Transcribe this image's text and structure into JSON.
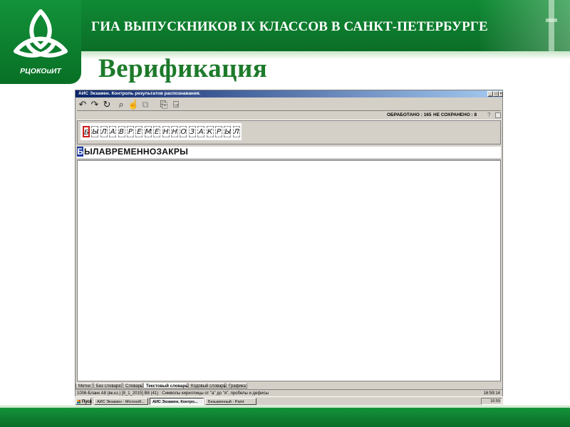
{
  "slide": {
    "header_title": "ГИА ВЫПУСКНИКОВ IX КЛАССОВ В САНКТ-ПЕТЕРБУРГЕ",
    "page_title": "Верификация",
    "logo_text": "РЦОКОиИТ"
  },
  "app": {
    "window_title": "АИС Экзамен. Контроль результатов распознавания.",
    "processed": "ОБРАБОТАНО : 165",
    "unsaved": "НЕ СОХРАНЕНО : 8",
    "help_glyph": "?",
    "scan_letters": [
      "Б",
      "Ы",
      "Л",
      "А",
      "В",
      "Р",
      "Е",
      "М",
      "Е",
      "Н",
      "Н",
      "О",
      "З",
      "А",
      "К",
      "Р",
      "Ы",
      "Л"
    ],
    "recognized_first": "Б",
    "recognized_rest": "ЫЛАВРЕМЕННОЗАКРЫ",
    "tabs": [
      "Метки",
      "Без словаря",
      "Словарь",
      "Текстовый словарь",
      "Кодовый словарь",
      "Графика"
    ],
    "active_tab": "Текстовый словарь",
    "status_text": "1006-Бланк А8 (вк.кз.) [8_1_2015]  В8 (41) : Символы кириллицы от \"а\" до \"я\", пробелы и дефисы",
    "status_time": "16:59:14"
  },
  "taskbar": {
    "start": "Пуск",
    "tasks": [
      "АИС Экзамен - Microsoft...",
      "АИС Экзамен. Контро...",
      "Безымянный - Paint"
    ],
    "tray_time": "16:59"
  },
  "icons": [
    "undo-icon",
    "redo-icon",
    "refresh-icon",
    "magnify-icon",
    "hand-icon",
    "copy-icon",
    "export-icon",
    "exit-icon",
    "help-icon",
    "minimize-icon",
    "maximize-icon",
    "close-icon"
  ],
  "colors": {
    "brand_green": "#0f8a34",
    "title_green": "#1d7a2a",
    "titlebar_blue": "#0a246a"
  }
}
